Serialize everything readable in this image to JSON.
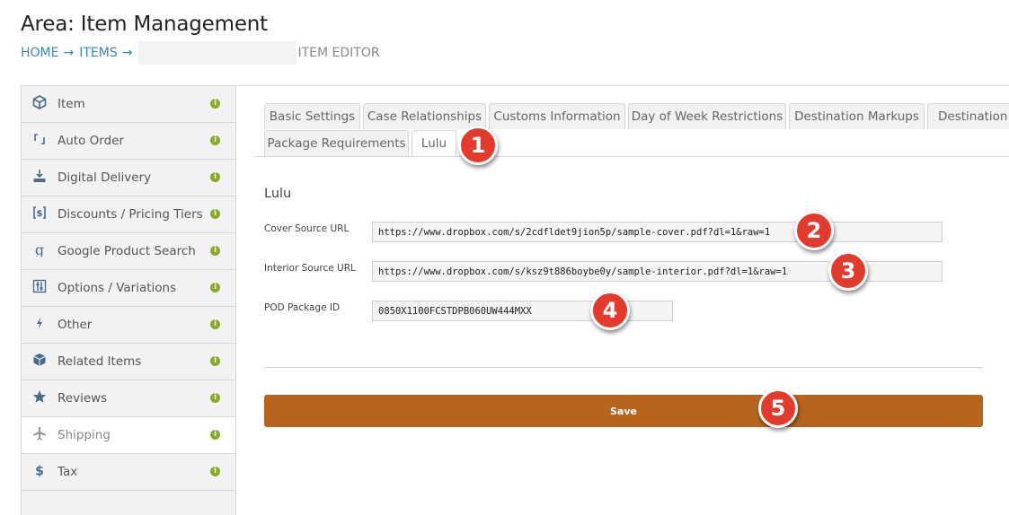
{
  "page": {
    "title": "Area: Item Management",
    "breadcrumb": {
      "home": "HOME",
      "items": "ITEMS",
      "arrow": "→",
      "current": "ITEM EDITOR"
    }
  },
  "sidebar": {
    "status_glyph": "i",
    "items": [
      {
        "label": "Item",
        "icon": "cube-icon"
      },
      {
        "label": "Auto Order",
        "icon": "refresh-icon"
      },
      {
        "label": "Digital Delivery",
        "icon": "download-icon"
      },
      {
        "label": "Discounts / Pricing Tiers",
        "icon": "dollar-box-icon"
      },
      {
        "label": "Google Product Search",
        "icon": "google-icon"
      },
      {
        "label": "Options / Variations",
        "icon": "sliders-icon"
      },
      {
        "label": "Other",
        "icon": "bolt-icon"
      },
      {
        "label": "Related Items",
        "icon": "cubes-icon"
      },
      {
        "label": "Reviews",
        "icon": "star-icon"
      },
      {
        "label": "Shipping",
        "icon": "plane-icon",
        "active": true
      },
      {
        "label": "Tax",
        "icon": "dollar-icon"
      }
    ]
  },
  "tabs": {
    "row1": [
      "Basic Settings",
      "Case Relationships",
      "Customs Information",
      "Day of Week Restrictions",
      "Destination Markups",
      "Destination R"
    ],
    "row2": [
      "Package Requirements",
      "Lulu"
    ],
    "active": "Lulu"
  },
  "lulu": {
    "title": "Lulu",
    "cover_label": "Cover Source URL",
    "cover_value": "https://www.dropbox.com/s/2cdfldet9jion5p/sample-cover.pdf?dl=1&raw=1",
    "interior_label": "Interior Source URL",
    "interior_value": "https://www.dropbox.com/s/ksz9t886boybe0y/sample-interior.pdf?dl=1&raw=1",
    "pod_label": "POD Package ID",
    "pod_value": "0850X1100FCSTDPB060UW444MXX"
  },
  "save_label": "Save",
  "callouts": [
    "1",
    "2",
    "3",
    "4",
    "5"
  ],
  "colors": {
    "accent": "#b5651d",
    "link": "#3a86b5",
    "status": "#8aa82e",
    "callout": "#e23b2e"
  }
}
